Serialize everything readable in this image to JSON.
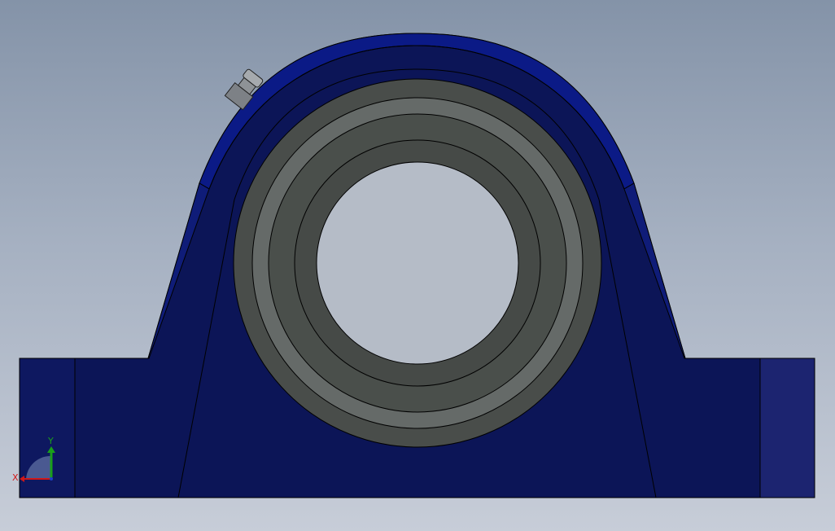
{
  "viewport": {
    "background_top": "#8493a8",
    "background_bottom": "#c7cdd8"
  },
  "model": {
    "housing_color": "#0c1557",
    "housing_highlight": "#1a2480",
    "housing_rim_color": "#0b1a86",
    "end_block_color": "#1c2470",
    "insert_color": "#494d4a",
    "insert_highlight": "#656a68",
    "bore_color": "#b5bcc7",
    "grease_fitting_color": "#8e9296"
  },
  "triad": {
    "x_label": "X",
    "y_label": "Y",
    "x_color": "#d01818",
    "y_color": "#1aa01a",
    "z_color": "#1f3cc8"
  }
}
